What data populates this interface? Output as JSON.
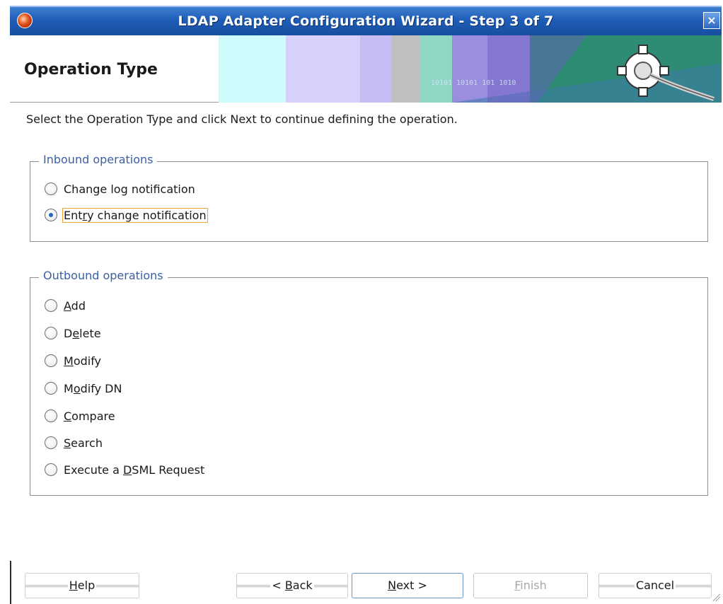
{
  "window": {
    "title": "LDAP Adapter Configuration Wizard - Step 3 of 7",
    "close_glyph": "×"
  },
  "header": {
    "title": "Operation Type",
    "banner_text": "10101 10101 101 1010"
  },
  "instruction": "Select the Operation Type and click Next to continue defining the operation.",
  "inbound": {
    "legend": "Inbound operations",
    "options": [
      {
        "pre": "Chan",
        "mn": "g",
        "post": "e log notification",
        "checked": false
      },
      {
        "pre": "Ent",
        "mn": "r",
        "post": "y change notification",
        "checked": true
      }
    ]
  },
  "outbound": {
    "legend": "Outbound operations",
    "options": [
      {
        "pre": "",
        "mn": "A",
        "post": "dd"
      },
      {
        "pre": "D",
        "mn": "e",
        "post": "lete"
      },
      {
        "pre": "",
        "mn": "M",
        "post": "odify"
      },
      {
        "pre": "M",
        "mn": "o",
        "post": "dify DN"
      },
      {
        "pre": "",
        "mn": "C",
        "post": "ompare"
      },
      {
        "pre": "",
        "mn": "S",
        "post": "earch"
      },
      {
        "pre": "Execute a ",
        "mn": "D",
        "post": "SML Request"
      }
    ]
  },
  "buttons": {
    "help": {
      "pre": "",
      "mn": "H",
      "post": "elp"
    },
    "back": {
      "pre": "< ",
      "mn": "B",
      "post": "ack"
    },
    "next": {
      "pre": "",
      "mn": "N",
      "post": "ext >"
    },
    "finish": {
      "pre": "",
      "mn": "F",
      "post": "inish"
    },
    "cancel": {
      "pre": "",
      "mn": "",
      "post": "Cancel"
    }
  },
  "colors": {
    "titlebar": "#1e5db7",
    "legend": "#3a5fa8",
    "focus_ring": "#f0a23a",
    "default_button_border": "#6c93cf"
  }
}
